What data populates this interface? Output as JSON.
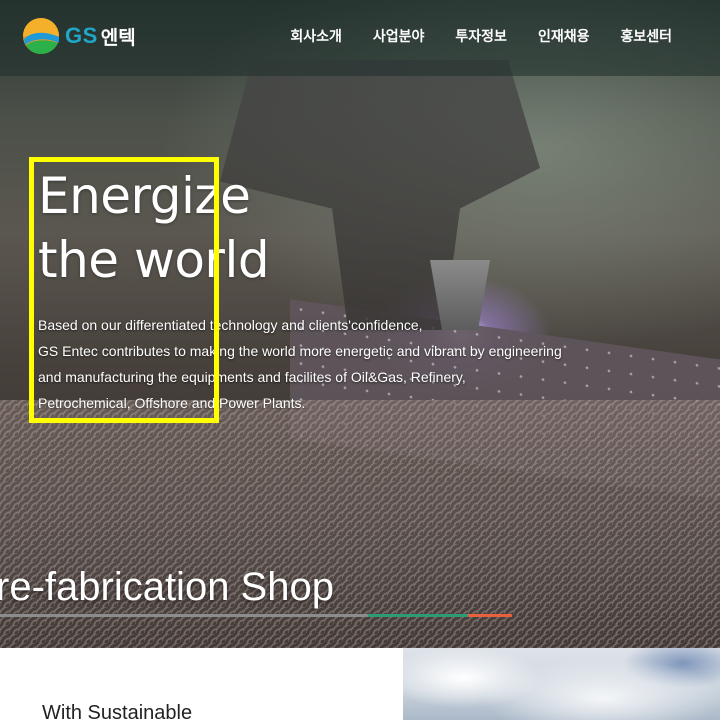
{
  "header": {
    "logo": {
      "brand": "GS",
      "name_kr": "엔텍"
    },
    "nav": [
      {
        "label": "회사소개"
      },
      {
        "label": "사업분야"
      },
      {
        "label": "투자정보"
      },
      {
        "label": "인재채용"
      },
      {
        "label": "홍보센터"
      }
    ]
  },
  "hero": {
    "headline_line1": "Energize",
    "headline_line2": "the world",
    "description": [
      "Based on our differentiated technology and clients'confidence,",
      "GS Entec contributes to making the world more energetic and vibrant by engineering",
      "and manufacturing the equipments and facilites of Oil&Gas, Refinery,",
      "Petrochemical, Offshore and Power Plants."
    ],
    "slide_caption": "re-fabrication Shop",
    "slide_progress": 0.71
  },
  "section": {
    "title": "With Sustainable"
  },
  "colors": {
    "highlight": "#ffff00",
    "logo_blue": "#20a7c8",
    "progress_green": "#2f9b74",
    "progress_orange": "#e8603c"
  }
}
